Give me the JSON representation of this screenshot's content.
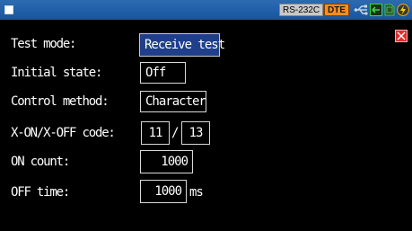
{
  "status_bar": {
    "interface": "RS-232C",
    "mode_badge": "DTE",
    "icons": [
      "menu-square-icon",
      "usb-icon",
      "lan-icon",
      "sd-card-icon",
      "power-icon"
    ],
    "colors": {
      "bar": "#1f5ea9",
      "dte_badge": "#ff8c1a",
      "interface_badge": "#c8c8c8"
    }
  },
  "form": {
    "test_mode": {
      "label": "Test mode:",
      "value": "Receive test"
    },
    "initial_state": {
      "label": "Initial state:",
      "value": "Off"
    },
    "control_method": {
      "label": "Control method:",
      "value": "Character"
    },
    "xon_xoff_code": {
      "label": "X-ON/X-OFF code:",
      "xon": "11",
      "separator": "/",
      "xoff": "13"
    },
    "on_count": {
      "label": "ON count:",
      "value": "1000"
    },
    "off_time": {
      "label": "OFF time:",
      "value": "1000",
      "unit": "ms"
    }
  },
  "colors": {
    "selected_field": "#1f3f8a",
    "close_button": "#e22c2c"
  }
}
